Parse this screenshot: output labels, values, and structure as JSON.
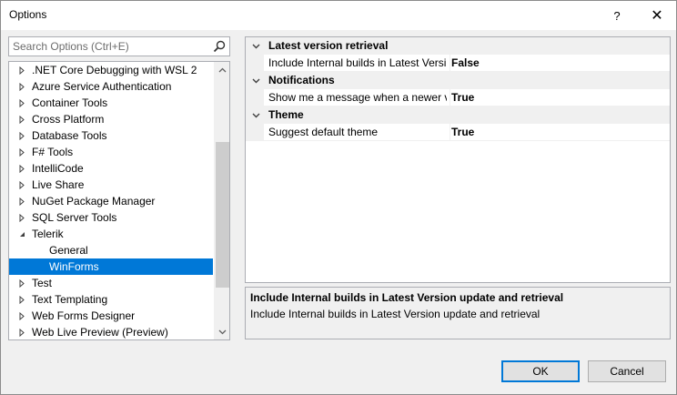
{
  "window": {
    "title": "Options",
    "help_glyph": "?",
    "close_glyph": "✕"
  },
  "search": {
    "placeholder": "Search Options (Ctrl+E)",
    "value": ""
  },
  "tree": {
    "items": [
      {
        "label": ".NET Core Debugging with WSL 2",
        "level": 0,
        "expander": "collapsed",
        "selected": false
      },
      {
        "label": "Azure Service Authentication",
        "level": 0,
        "expander": "collapsed",
        "selected": false
      },
      {
        "label": "Container Tools",
        "level": 0,
        "expander": "collapsed",
        "selected": false
      },
      {
        "label": "Cross Platform",
        "level": 0,
        "expander": "collapsed",
        "selected": false
      },
      {
        "label": "Database Tools",
        "level": 0,
        "expander": "collapsed",
        "selected": false
      },
      {
        "label": "F# Tools",
        "level": 0,
        "expander": "collapsed",
        "selected": false
      },
      {
        "label": "IntelliCode",
        "level": 0,
        "expander": "collapsed",
        "selected": false
      },
      {
        "label": "Live Share",
        "level": 0,
        "expander": "collapsed",
        "selected": false
      },
      {
        "label": "NuGet Package Manager",
        "level": 0,
        "expander": "collapsed",
        "selected": false
      },
      {
        "label": "SQL Server Tools",
        "level": 0,
        "expander": "collapsed",
        "selected": false
      },
      {
        "label": "Telerik",
        "level": 0,
        "expander": "expanded",
        "selected": false
      },
      {
        "label": "General",
        "level": 1,
        "expander": "none",
        "selected": false
      },
      {
        "label": "WinForms",
        "level": 1,
        "expander": "none",
        "selected": true
      },
      {
        "label": "Test",
        "level": 0,
        "expander": "collapsed",
        "selected": false
      },
      {
        "label": "Text Templating",
        "level": 0,
        "expander": "collapsed",
        "selected": false
      },
      {
        "label": "Web Forms Designer",
        "level": 0,
        "expander": "collapsed",
        "selected": false
      },
      {
        "label": "Web Live Preview (Preview)",
        "level": 0,
        "expander": "collapsed",
        "selected": false
      }
    ]
  },
  "property_grid": {
    "categories": [
      {
        "name": "Latest version retrieval",
        "properties": [
          {
            "name": "Include Internal builds in Latest Version update and retrieval",
            "value": "False"
          }
        ]
      },
      {
        "name": "Notifications",
        "properties": [
          {
            "name": "Show me a message when a newer version is available",
            "value": "True"
          }
        ]
      },
      {
        "name": "Theme",
        "properties": [
          {
            "name": "Suggest default theme",
            "value": "True"
          }
        ]
      }
    ]
  },
  "description": {
    "title": "Include Internal builds in Latest Version update and retrieval",
    "text": "Include Internal builds in Latest Version update and retrieval"
  },
  "buttons": {
    "ok": "OK",
    "cancel": "Cancel"
  },
  "colors": {
    "selection": "#0078d7",
    "dialog_bg": "#f0f0f0",
    "border": "#abadb3"
  }
}
